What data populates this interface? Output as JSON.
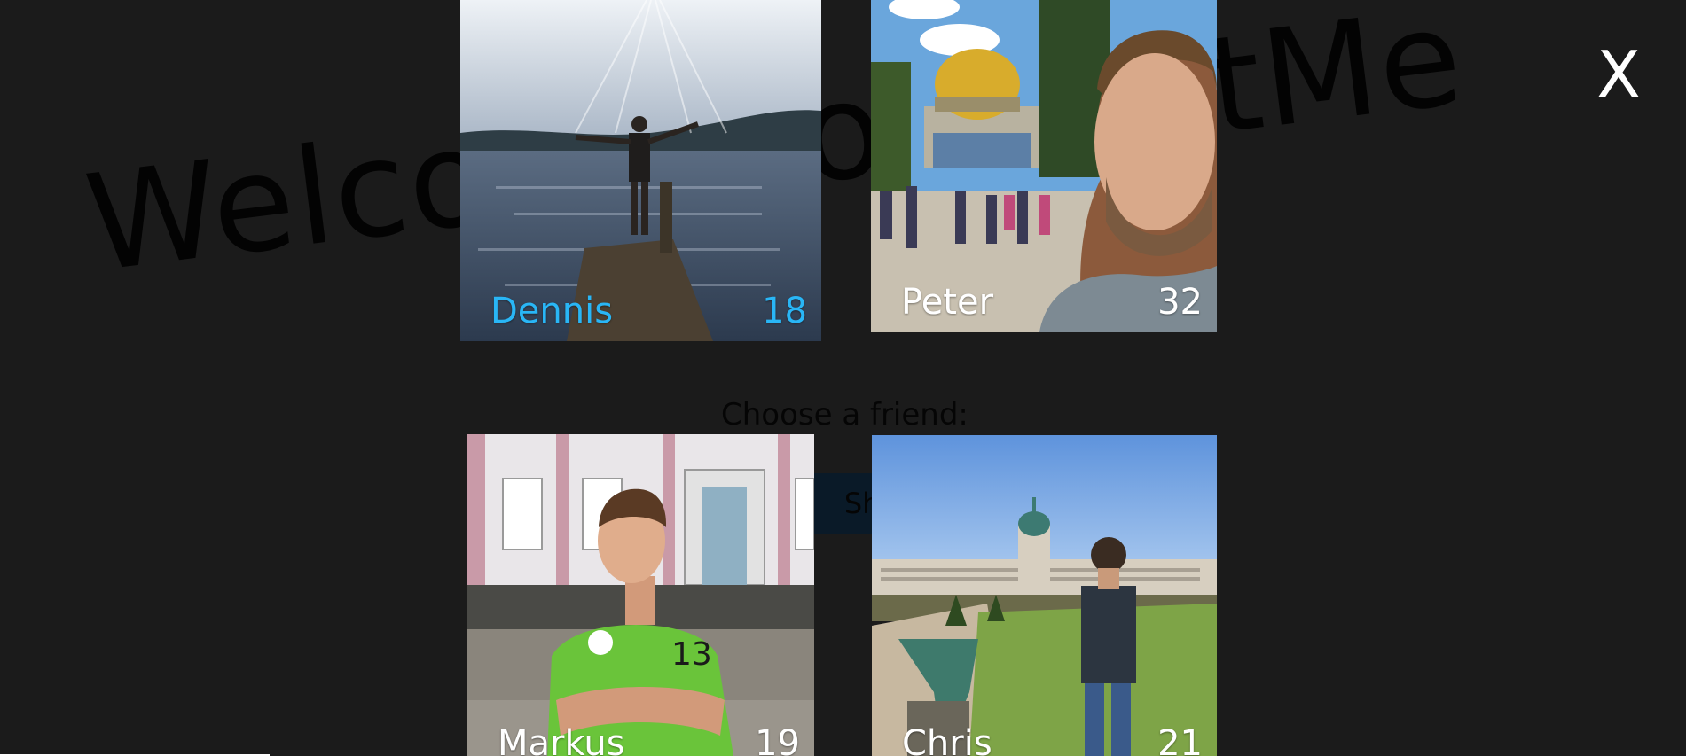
{
  "background": {
    "welcome_text": "Welcome to MeetMe",
    "prompt": "Choose a friend:",
    "button_label": "Show"
  },
  "modal": {
    "close_label": "X",
    "friends": [
      {
        "name": "Dennis",
        "age": "18",
        "selected": true,
        "photo": "man-arms-raised-at-lake"
      },
      {
        "name": "Peter",
        "age": "32",
        "selected": false,
        "photo": "selfie-at-dome-of-the-rock"
      },
      {
        "name": "Markus",
        "age": "19",
        "selected": false,
        "photo": "boy-green-jersey-palace"
      },
      {
        "name": "Chris",
        "age": "21",
        "selected": false,
        "photo": "man-back-facing-palace-garden"
      }
    ]
  },
  "colors": {
    "background": "#1b1b1b",
    "selected_text": "#29b6f6",
    "text": "#ffffff"
  }
}
